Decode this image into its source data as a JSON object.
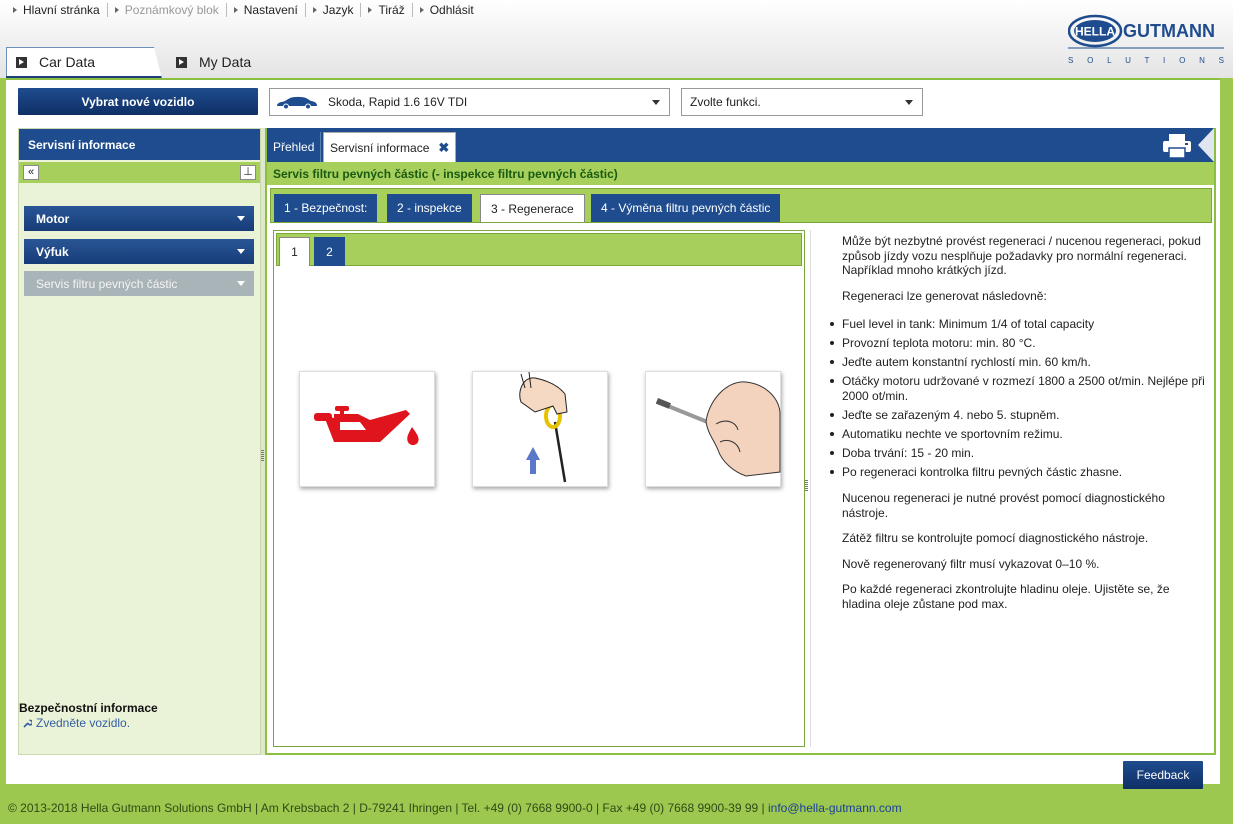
{
  "topnav": [
    {
      "label": "Hlavní stránka",
      "enabled": true
    },
    {
      "label": "Poznámkový blok",
      "enabled": false
    },
    {
      "label": "Nastavení",
      "enabled": true
    },
    {
      "label": "Jazyk",
      "enabled": true
    },
    {
      "label": "Tiráž",
      "enabled": true
    },
    {
      "label": "Odhlásit",
      "enabled": true
    }
  ],
  "logo": {
    "brand_left": "HELLA",
    "brand_right": "GUTMANN",
    "tagline": "S O L U T I O N S"
  },
  "main_tabs": {
    "car": "Car Data",
    "my": "My Data"
  },
  "toolbar": {
    "new_vehicle": "Vybrat nové vozidlo",
    "vehicle": "Skoda, Rapid 1.6 16V TDI",
    "function": "Zvolte funkci."
  },
  "sidebar": {
    "title": "Servisní informace",
    "collapse_icon": "«",
    "pin_icon": "⊥",
    "items": [
      {
        "label": "Motor",
        "state": "active"
      },
      {
        "label": "Výfuk",
        "state": "active"
      },
      {
        "label": "Servis filtru pevných částic",
        "state": "selected"
      }
    ],
    "safety_title": "Bezpečnostní informace",
    "safety_link": "Zvedněte vozidlo."
  },
  "content_tabs": {
    "overview": "Přehled",
    "service": "Servisní informace",
    "close": "✖"
  },
  "section_title": "Servis filtru pevných částic (- inspekce filtru pevných částic)",
  "step_tabs": [
    "1 - Bezpečnost:",
    "2 - inspekce",
    "3 - Regenerace",
    "4 - Výměna filtru pevných částic"
  ],
  "selected_step": 2,
  "image_tabs": [
    "1",
    "2"
  ],
  "images": [
    "oil-can-warning-icon",
    "dipstick-pull-icon",
    "dipstick-read-icon"
  ],
  "text": {
    "p1": "Může být nezbytné provést regeneraci / nucenou regeneraci, pokud způsob jízdy vozu nesplňuje požadavky pro normální regeneraci. Například mnoho krátkých jízd.",
    "p2": "Regeneraci lze generovat následovně:",
    "bullets": [
      "Fuel level in tank: Minimum 1/4 of total capacity",
      "Provozní teplota motoru: min. 80 °C.",
      "Jeďte autem konstantní rychlostí min. 60 km/h.",
      "Otáčky motoru udržované v rozmezí 1800 a 2500 ot/min. Nejlépe při 2000 ot/min.",
      "Jeďte se zařazeným 4. nebo 5. stupněm.",
      "Automatiku nechte ve sportovním režimu.",
      "Doba trvání: 15 - 20 min.",
      "Po regeneraci kontrolka filtru pevných částic zhasne."
    ],
    "p3": "Nucenou regeneraci je nutné provést pomocí diagnostického nástroje.",
    "p4": "Zátěž filtru se kontrolujte pomocí diagnostického nástroje.",
    "p5": "Nově regenerovaný filtr musí vykazovat 0–10 %.",
    "p6": "Po každé regeneraci zkontrolujte hladinu oleje. Ujistěte se, že hladina oleje zůstane pod max."
  },
  "feedback": "Feedback",
  "footer": {
    "text": "© 2013-2018 Hella Gutmann Solutions GmbH | Am Krebsbach 2 | D-79241 Ihringen | Tel. +49 (0) 7668 9900-0 | Fax +49 (0) 7668 9900-39 99 | ",
    "email": "info@hella-gutmann.com"
  },
  "colors": {
    "brand_blue": "#1f4c8e",
    "accent_green": "#a6cf5c",
    "background_green": "#9dc84f"
  }
}
